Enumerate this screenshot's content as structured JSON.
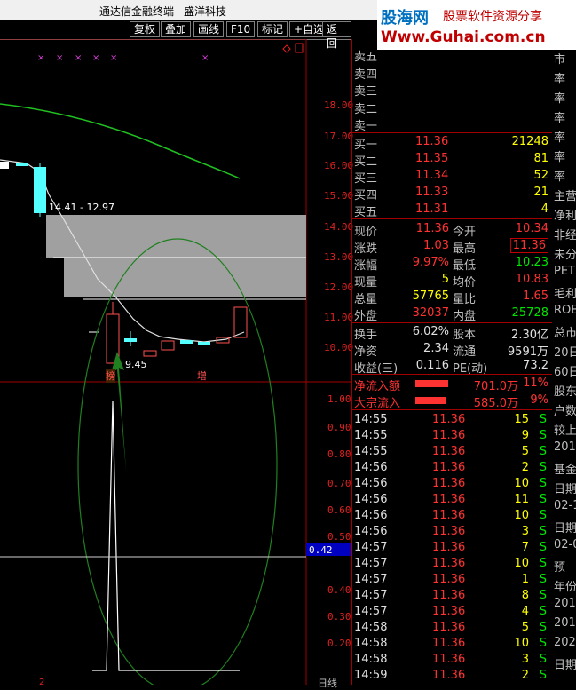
{
  "titlebar": {
    "app": "通达信金融终端",
    "vendor": "盛洋科技"
  },
  "toolbar": {
    "buttons": [
      "复权",
      "叠加",
      "画线",
      "F10",
      "标记",
      "+自选",
      "返回"
    ]
  },
  "logo": {
    "name": "股海网",
    "slogan": "股票软件资源分享",
    "url": "Www.Guhai.com.cn"
  },
  "price_axis": {
    "ticks": [
      "18.00",
      "17.00",
      "16.00",
      "15.00",
      "14.00",
      "13.00",
      "12.00",
      "11.00",
      "10.00"
    ]
  },
  "indicator_axis": {
    "ticks": [
      "1.00",
      "0.90",
      "0.80",
      "0.70",
      "0.60",
      "0.50",
      "0.40",
      "0.30",
      "0.20"
    ],
    "current": "0.42"
  },
  "chart_annotations": {
    "range_label": "14.41 - 12.97",
    "low_label": "9.45",
    "mark_1": "榜",
    "mark_2": "增",
    "bottom_label": "日线",
    "bottom_left": "2"
  },
  "order_book": {
    "asks": [
      {
        "label": "卖五",
        "price": "",
        "vol": ""
      },
      {
        "label": "卖四",
        "price": "",
        "vol": ""
      },
      {
        "label": "卖三",
        "price": "",
        "vol": ""
      },
      {
        "label": "卖二",
        "price": "",
        "vol": ""
      },
      {
        "label": "卖一",
        "price": "",
        "vol": ""
      }
    ],
    "bids": [
      {
        "label": "买一",
        "price": "11.36",
        "vol": "21248"
      },
      {
        "label": "买二",
        "price": "11.35",
        "vol": "81"
      },
      {
        "label": "买三",
        "price": "11.34",
        "vol": "52"
      },
      {
        "label": "买四",
        "price": "11.33",
        "vol": "21"
      },
      {
        "label": "买五",
        "price": "11.31",
        "vol": "4"
      }
    ]
  },
  "stats": [
    {
      "l1": "现价",
      "v1": "11.36",
      "c1": "red",
      "l2": "今开",
      "v2": "10.34",
      "c2": "red"
    },
    {
      "l1": "涨跌",
      "v1": "1.03",
      "c1": "red",
      "l2": "最高",
      "v2": "11.36",
      "c2": "red"
    },
    {
      "l1": "涨幅",
      "v1": "9.97%",
      "c1": "red",
      "l2": "最低",
      "v2": "10.23",
      "c2": "grn"
    },
    {
      "l1": "现量",
      "v1": "5",
      "c1": "yel",
      "l2": "均价",
      "v2": "10.83",
      "c2": "red"
    },
    {
      "l1": "总量",
      "v1": "57765",
      "c1": "yel",
      "l2": "量比",
      "v2": "1.65",
      "c2": "red"
    },
    {
      "l1": "外盘",
      "v1": "32037",
      "c1": "red",
      "l2": "内盘",
      "v2": "25728",
      "c2": "grn"
    }
  ],
  "fundamentals": [
    {
      "l1": "换手",
      "v1": "6.02%",
      "l2": "股本",
      "v2": "2.30亿"
    },
    {
      "l1": "净资",
      "v1": "2.34",
      "l2": "流通",
      "v2": "9591万"
    },
    {
      "l1": "收益(三)",
      "v1": "0.116",
      "l2": "PE(动)",
      "v2": "73.2"
    }
  ],
  "flows": [
    {
      "label": "净流入额",
      "value": "701.0万",
      "pct": "11%",
      "bar": 0.55
    },
    {
      "label": "大宗流入",
      "value": "585.0万",
      "pct": "9%",
      "bar": 0.5
    }
  ],
  "ticks": [
    {
      "time": "14:55",
      "price": "11.36",
      "vol": "15",
      "side": "S"
    },
    {
      "time": "14:55",
      "price": "11.36",
      "vol": "9",
      "side": "S"
    },
    {
      "time": "14:55",
      "price": "11.36",
      "vol": "5",
      "side": "S"
    },
    {
      "time": "14:56",
      "price": "11.36",
      "vol": "2",
      "side": "S"
    },
    {
      "time": "14:56",
      "price": "11.36",
      "vol": "10",
      "side": "S"
    },
    {
      "time": "14:56",
      "price": "11.36",
      "vol": "11",
      "side": "S"
    },
    {
      "time": "14:56",
      "price": "11.36",
      "vol": "10",
      "side": "S"
    },
    {
      "time": "14:56",
      "price": "11.36",
      "vol": "3",
      "side": "S"
    },
    {
      "time": "14:57",
      "price": "11.36",
      "vol": "7",
      "side": "S"
    },
    {
      "time": "14:57",
      "price": "11.36",
      "vol": "10",
      "side": "S"
    },
    {
      "time": "14:57",
      "price": "11.36",
      "vol": "1",
      "side": "S"
    },
    {
      "time": "14:57",
      "price": "11.36",
      "vol": "8",
      "side": "S"
    },
    {
      "time": "14:57",
      "price": "11.36",
      "vol": "4",
      "side": "S"
    },
    {
      "time": "14:58",
      "price": "11.36",
      "vol": "5",
      "side": "S"
    },
    {
      "time": "14:58",
      "price": "11.36",
      "vol": "10",
      "side": "S"
    },
    {
      "time": "14:58",
      "price": "11.36",
      "vol": "3",
      "side": "S"
    },
    {
      "time": "14:59",
      "price": "11.36",
      "vol": "2",
      "side": "S"
    }
  ],
  "right_strip": [
    "市",
    "率",
    "率",
    "率",
    "率",
    "率",
    "率",
    "主营",
    "净利",
    "非经",
    "未分",
    "PET",
    "毛利",
    "ROE",
    "总市",
    "20日",
    "60日",
    "股东",
    "户数",
    "较上",
    "201",
    "基金",
    "日期",
    "02-1",
    "日期",
    "02-0",
    "预",
    "年份",
    "201",
    "201",
    "202",
    "日期"
  ]
}
